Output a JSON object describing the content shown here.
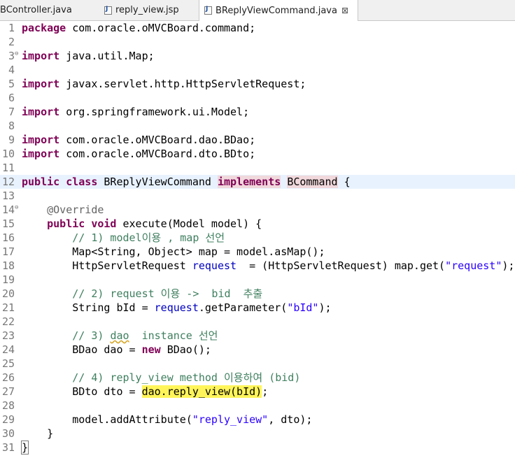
{
  "tabs": [
    {
      "label": "BController.java"
    },
    {
      "label": "reply_view.jsp"
    },
    {
      "label": "BReplyViewCommand.java",
      "close": "⊠"
    }
  ],
  "lines": [
    {
      "n": "1",
      "s": [
        {
          "c": "kw",
          "t": "package"
        },
        {
          "t": " com.oracle.oMVCBoard.command;"
        }
      ]
    },
    {
      "n": "2",
      "s": []
    },
    {
      "n": "3",
      "fold": "⊖",
      "s": [
        {
          "c": "kw",
          "t": "import"
        },
        {
          "t": " java.util.Map;"
        }
      ]
    },
    {
      "n": "4",
      "s": []
    },
    {
      "n": "5",
      "s": [
        {
          "c": "kw",
          "t": "import"
        },
        {
          "t": " javax.servlet.http.HttpServletRequest;"
        }
      ]
    },
    {
      "n": "6",
      "s": []
    },
    {
      "n": "7",
      "s": [
        {
          "c": "kw",
          "t": "import"
        },
        {
          "t": " org.springframework.ui.Model;"
        }
      ]
    },
    {
      "n": "8",
      "s": []
    },
    {
      "n": "9",
      "s": [
        {
          "c": "kw",
          "t": "import"
        },
        {
          "t": " com.oracle.oMVCBoard.dao.BDao;"
        }
      ]
    },
    {
      "n": "10",
      "s": [
        {
          "c": "kw",
          "t": "import"
        },
        {
          "t": " com.oracle.oMVCBoard.dto.BDto;"
        }
      ]
    },
    {
      "n": "11",
      "s": []
    },
    {
      "n": "12",
      "cur": true,
      "s": [
        {
          "c": "kw",
          "t": "public"
        },
        {
          "t": " "
        },
        {
          "c": "kw",
          "t": "class"
        },
        {
          "t": " BReplyViewCommand "
        },
        {
          "c": "kw hl1",
          "t": "implements"
        },
        {
          "t": " "
        },
        {
          "c": "hl1",
          "t": "BCommand"
        },
        {
          "t": " {"
        }
      ]
    },
    {
      "n": "13",
      "s": []
    },
    {
      "n": "14",
      "fold": "⊖",
      "s": [
        {
          "t": "    "
        },
        {
          "c": "ann",
          "t": "@Override"
        }
      ]
    },
    {
      "n": "15",
      "s": [
        {
          "t": "    "
        },
        {
          "c": "kw",
          "t": "public"
        },
        {
          "t": " "
        },
        {
          "c": "kw",
          "t": "void"
        },
        {
          "t": " execute(Model model) {"
        }
      ]
    },
    {
      "n": "16",
      "s": [
        {
          "t": "        "
        },
        {
          "c": "cm",
          "t": "// 1) model이용 , map 선언"
        }
      ]
    },
    {
      "n": "17",
      "s": [
        {
          "t": "        Map<String, Object> map = model.asMap();"
        }
      ]
    },
    {
      "n": "18",
      "s": [
        {
          "t": "        HttpServletRequest "
        },
        {
          "c": "fld",
          "t": "request"
        },
        {
          "t": "  = (HttpServletRequest) map.get("
        },
        {
          "c": "st",
          "t": "\"request\""
        },
        {
          "t": ");"
        }
      ]
    },
    {
      "n": "19",
      "s": []
    },
    {
      "n": "20",
      "s": [
        {
          "t": "        "
        },
        {
          "c": "cm",
          "t": "// 2) request 이용 ->  bid  추출"
        }
      ]
    },
    {
      "n": "21",
      "s": [
        {
          "t": "        String bId = "
        },
        {
          "c": "fld",
          "t": "request"
        },
        {
          "t": ".getParameter("
        },
        {
          "c": "st",
          "t": "\"bId\""
        },
        {
          "t": ");"
        }
      ]
    },
    {
      "n": "22",
      "s": []
    },
    {
      "n": "23",
      "s": [
        {
          "t": "        "
        },
        {
          "c": "cm",
          "t": "// 3) "
        },
        {
          "c": "cm sq",
          "t": "dao"
        },
        {
          "c": "cm",
          "t": "  instance 선언"
        }
      ]
    },
    {
      "n": "24",
      "s": [
        {
          "t": "        BDao dao = "
        },
        {
          "c": "kw",
          "t": "new"
        },
        {
          "t": " BDao();"
        }
      ]
    },
    {
      "n": "25",
      "s": []
    },
    {
      "n": "26",
      "s": [
        {
          "t": "        "
        },
        {
          "c": "cm",
          "t": "// 4) reply_view method 이용하여 (bid)"
        }
      ]
    },
    {
      "n": "27",
      "s": [
        {
          "t": "        BDto dto = "
        },
        {
          "c": "hl2",
          "t": "dao.reply_view(bId)"
        },
        {
          "t": ";"
        }
      ]
    },
    {
      "n": "28",
      "s": []
    },
    {
      "n": "29",
      "s": [
        {
          "t": "        model.addAttribute("
        },
        {
          "c": "st",
          "t": "\"reply_view\""
        },
        {
          "t": ", dto);"
        }
      ]
    },
    {
      "n": "30",
      "s": [
        {
          "t": "    }"
        }
      ]
    },
    {
      "n": "31",
      "s": [
        {
          "c": "brk",
          "t": "}"
        }
      ]
    }
  ]
}
